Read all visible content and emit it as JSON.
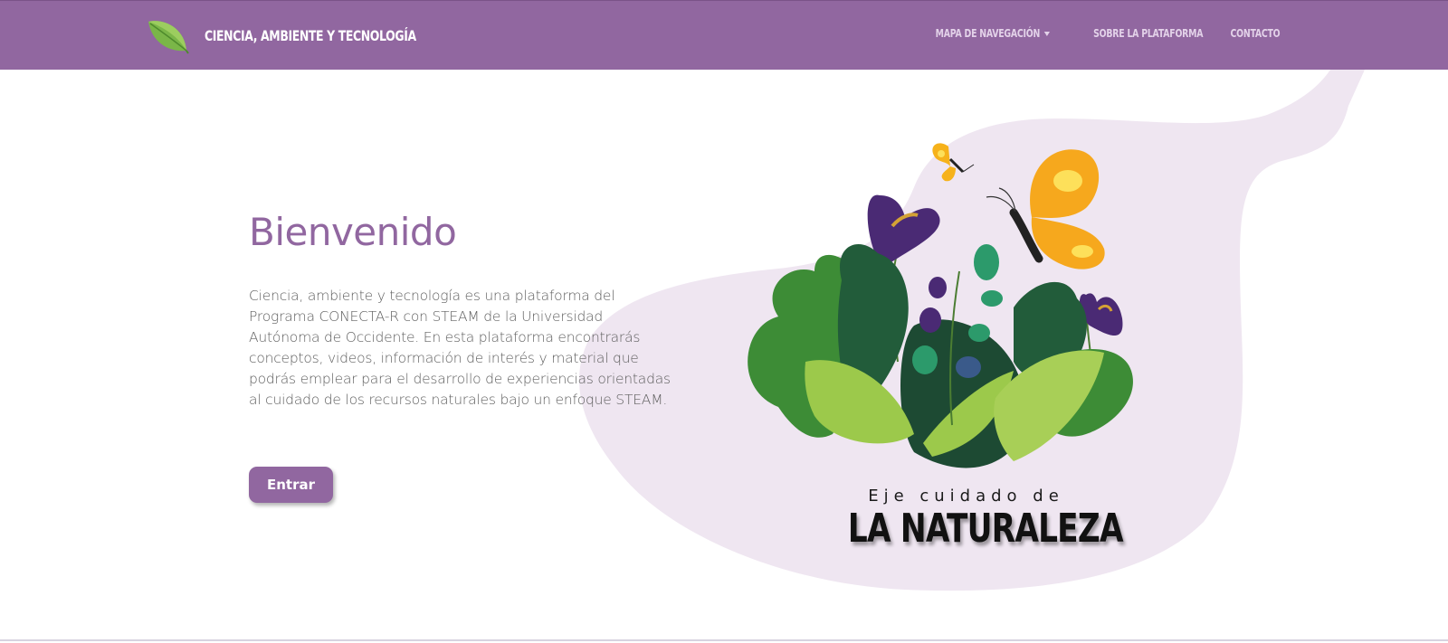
{
  "navbar": {
    "brand_title": "CIENCIA, AMBIENTE Y TECNOLOGÍA",
    "logo_icon": "leaf-icon",
    "links": [
      {
        "label": "MAPA DE NAVEGACIÓN",
        "has_dropdown": true
      },
      {
        "label": "SOBRE LA PLATAFORMA",
        "has_dropdown": false
      },
      {
        "label": "CONTACTO",
        "has_dropdown": false
      }
    ],
    "background_color": "#9167a0"
  },
  "hero": {
    "title": "Bienvenido",
    "description": "Ciencia, ambiente y tecnología es una plataforma del Programa CONECTA-R con STEAM de la Universidad Autónoma de Occidente. En esta plataforma encontrarás conceptos, videos, información de interés y material que podrás emplear para el desarrollo de experiencias orientadas al cuidado de los recursos naturales bajo un enfoque STEAM.",
    "button_label": "Entrar"
  },
  "illustration": {
    "subtitle": "Eje cuidado de",
    "title": "LA NATURALEZA",
    "icons": [
      "butterfly-icon",
      "flower-icon",
      "leaves-icon"
    ]
  },
  "colors": {
    "accent": "#9167a0",
    "blob": "#efe6f1",
    "text": "#5f5f5f"
  }
}
